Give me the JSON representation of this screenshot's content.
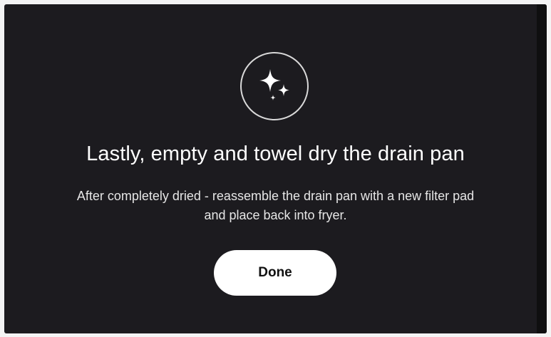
{
  "dialog": {
    "icon": "sparkles-icon",
    "title": "Lastly, empty and towel dry the drain pan",
    "body_line1": "After completely dried - reassemble the drain pan with a new filter pad",
    "body_line2": "and place back into fryer.",
    "done_label": "Done"
  },
  "colors": {
    "background": "#1c1b1f",
    "text": "#ffffff",
    "button": "#ffffff",
    "button_text": "#111111"
  }
}
